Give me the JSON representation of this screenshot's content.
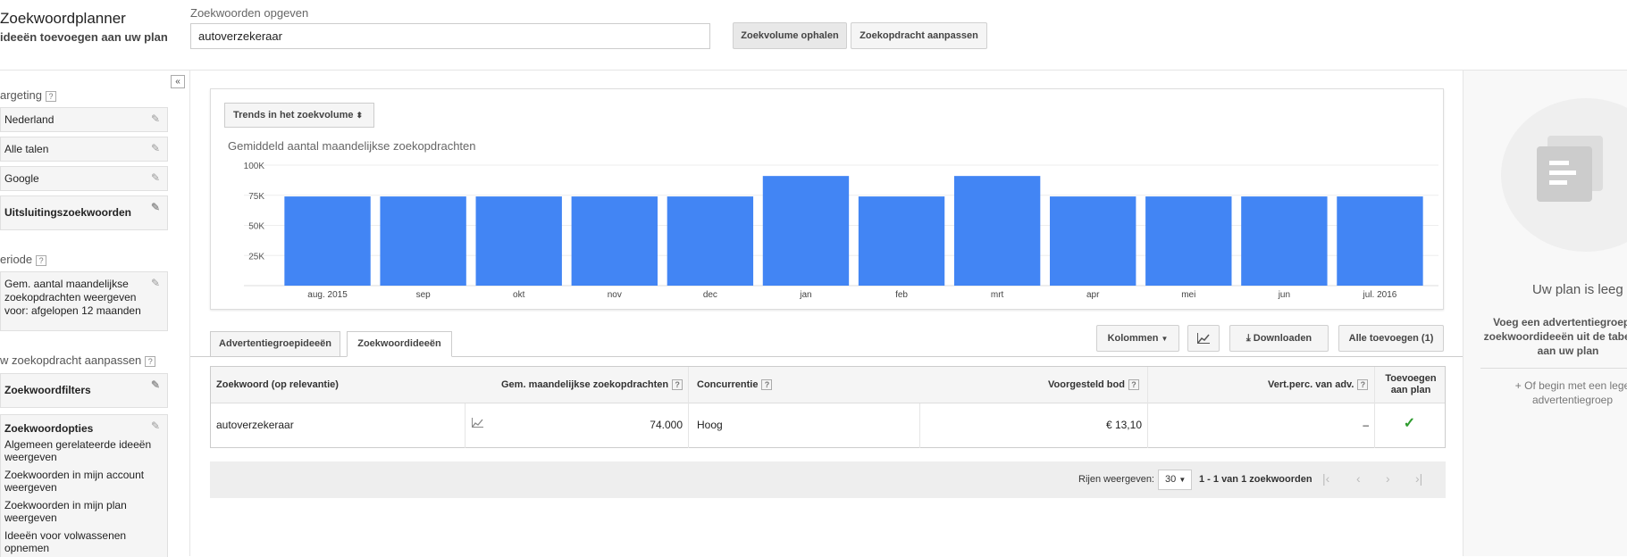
{
  "header": {
    "app_title": "Zoekwoordplanner",
    "app_subtitle": "ideeën toevoegen aan uw plan",
    "keyword_label": "Zoekwoorden opgeven",
    "keyword_value": "autoverzekeraar",
    "get_volume_button": "Zoekvolume ophalen",
    "adjust_button": "Zoekopdracht aanpassen"
  },
  "sidebar": {
    "collapse_icon": "double-chevron-left-icon",
    "targeting_title": "argeting",
    "help": "?",
    "targeting_items": [
      "Nederland",
      "Alle talen",
      "Google"
    ],
    "negative_keywords": "Uitsluitingszoekwoorden",
    "period_title": "eriode",
    "period_text": "Gem. aantal maandelijkse zoekopdrachten weergeven voor: afgelopen 12 maanden",
    "customize_title": "w zoekopdracht aanpassen",
    "keyword_filters": "Zoekwoordfilters",
    "keyword_options": "Zoekwoordopties",
    "options": [
      "Algemeen gerelateerde ideeën weergeven",
      "Zoekwoorden in mijn account weergeven",
      "Zoekwoorden in mijn plan weergeven",
      "Ideeën voor volwassenen opnemen"
    ]
  },
  "chart_panel": {
    "dropdown_label": "Trends in het zoekvolume",
    "chart_title": "Gemiddeld aantal maandelijkse zoekopdrachten"
  },
  "chart_data": {
    "type": "bar",
    "title": "Gemiddeld aantal maandelijkse zoekopdrachten",
    "categories": [
      "aug. 2015",
      "sep",
      "okt",
      "nov",
      "dec",
      "jan",
      "feb",
      "mrt",
      "apr",
      "mei",
      "jun",
      "jul. 2016"
    ],
    "values": [
      74000,
      74000,
      74000,
      74000,
      74000,
      91000,
      74000,
      91000,
      74000,
      74000,
      74000,
      74000
    ],
    "y_ticks": [
      "25K",
      "50K",
      "75K",
      "100K"
    ],
    "ylim": [
      0,
      100000
    ],
    "grid": true,
    "bar_color": "#4285f4"
  },
  "tabs": {
    "adgroups": "Advertentiegroepideeën",
    "keywords": "Zoekwoordideeën"
  },
  "toolbar": {
    "columns": "Kolommen",
    "download": "Downloaden",
    "add_all": "Alle toevoegen (1)"
  },
  "table": {
    "headers": {
      "keyword": "Zoekwoord (op relevantie)",
      "avg_searches": "Gem. maandelijkse zoekopdrachten",
      "competition": "Concurrentie",
      "suggested_bid": "Voorgesteld bod",
      "ad_share": "Vert.perc. van adv.",
      "add_to_plan": "Toevoegen aan plan"
    },
    "rows": [
      {
        "keyword": "autoverzekeraar",
        "avg_searches": "74.000",
        "competition": "Hoog",
        "suggested_bid": "€ 13,10",
        "ad_share": "–",
        "added": "✓"
      }
    ]
  },
  "pagination": {
    "rows_label": "Rijen weergeven:",
    "rows_value": "30",
    "range_text": "1 - 1 van 1 zoekwoorden"
  },
  "plan_panel": {
    "title": "Uw plan is leeg",
    "description": "Voeg een advertentiegroep of zoekwoordideeën uit de tabel toe aan uw plan",
    "hint": "+ Of begin met een lege advertentiegroep"
  },
  "colors": {
    "bar": "#4285f4",
    "check": "#2e9b2e"
  }
}
